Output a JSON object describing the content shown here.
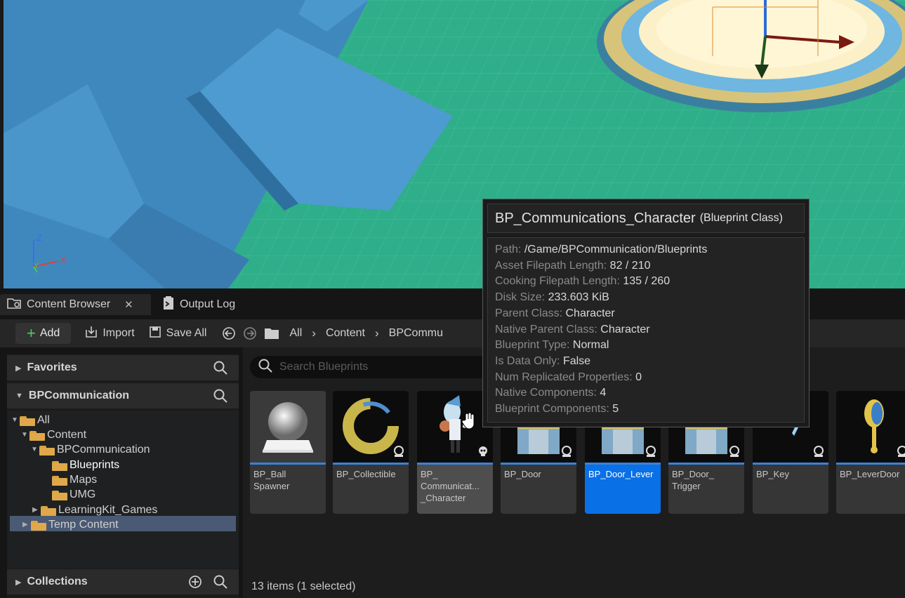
{
  "tabs": [
    {
      "label": "Content Browser",
      "icon": "content-browser-icon",
      "close": "✕"
    },
    {
      "label": "Output Log",
      "icon": "output-log-icon"
    }
  ],
  "toolbar": {
    "add_label": "Add",
    "import_label": "Import",
    "save_all_label": "Save All",
    "breadcrumbs": [
      "All",
      "Content",
      "BPCommu"
    ]
  },
  "left_panel": {
    "favorites_label": "Favorites",
    "project_label": "BPCommunication",
    "collections_label": "Collections",
    "tree": [
      {
        "label": "All"
      },
      {
        "label": "Content"
      },
      {
        "label": "BPCommunication"
      },
      {
        "label": "Blueprints",
        "selected": true
      },
      {
        "label": "Maps"
      },
      {
        "label": "UMG"
      },
      {
        "label": "LearningKit_Games"
      },
      {
        "label": "Temp Content"
      }
    ]
  },
  "search": {
    "placeholder": "Search Blueprints"
  },
  "assets": [
    {
      "label": "BP_Ball\nSpawner"
    },
    {
      "label": "BP_Collectible"
    },
    {
      "label": "BP_\nCommunicat...\n_Character",
      "hovered": true
    },
    {
      "label": "BP_Door"
    },
    {
      "label": "BP_Door_Lever",
      "selected": true
    },
    {
      "label": "BP_Door_\nTrigger"
    },
    {
      "label": "BP_Key"
    },
    {
      "label": "BP_LeverDoor"
    }
  ],
  "status_text": "13 items (1 selected)",
  "tooltip": {
    "title": "BP_Communications_Character",
    "class_label": "(Blueprint Class)",
    "rows": [
      {
        "key": "Path:",
        "value": "/Game/BPCommunication/Blueprints"
      },
      {
        "key": "Asset Filepath Length:",
        "value": "82 / 210"
      },
      {
        "key": "Cooking Filepath Length:",
        "value": "135 / 260"
      },
      {
        "key": "Disk Size:",
        "value": "233.603 KiB"
      },
      {
        "key": "Parent Class:",
        "value": "Character"
      },
      {
        "key": "Native Parent Class:",
        "value": "Character"
      },
      {
        "key": "Blueprint Type:",
        "value": "Normal"
      },
      {
        "key": "Is Data Only:",
        "value": "False"
      },
      {
        "key": "Num Replicated Properties:",
        "value": "0"
      },
      {
        "key": "Native Components:",
        "value": "4"
      },
      {
        "key": "Blueprint Components:",
        "value": "5"
      }
    ]
  },
  "viewport": {
    "axis_labels": [
      "Z",
      "X",
      "Y"
    ]
  },
  "colors": {
    "accent": "#0a70e6",
    "folder": "#e0a84a",
    "add_plus": "#4fcf5b"
  }
}
